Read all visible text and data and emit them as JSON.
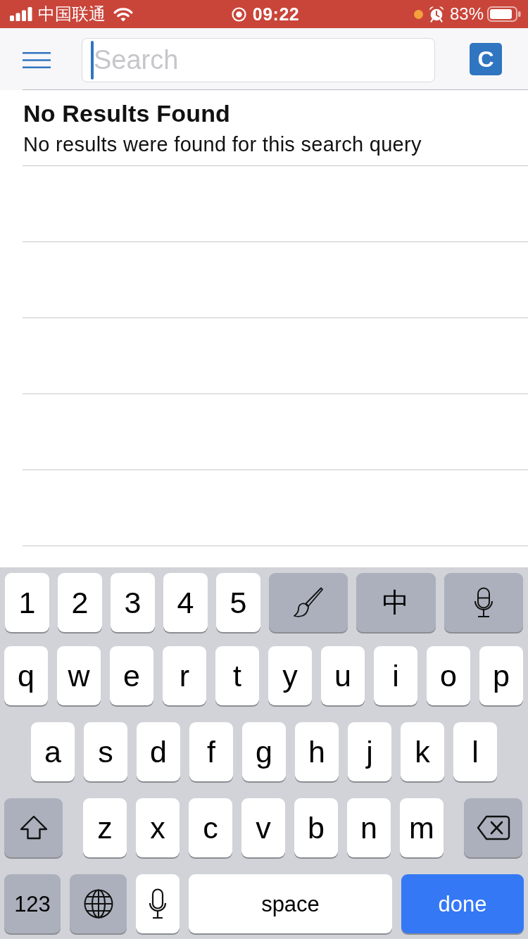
{
  "status_bar": {
    "carrier": "中国联通",
    "time": "09:22",
    "battery": "83%"
  },
  "nav_bar": {
    "search": {
      "placeholder": "Search"
    },
    "profile_initial": "C"
  },
  "results": {
    "title": "No Results Found",
    "message": "No results were found for this search query"
  },
  "keyboard": {
    "rows": [
      {
        "keys": [
          {
            "kind": "char",
            "dark": false,
            "label": "1"
          },
          {
            "kind": "char",
            "dark": false,
            "label": "2"
          },
          {
            "kind": "char",
            "dark": false,
            "label": "3"
          },
          {
            "kind": "char",
            "dark": false,
            "label": "4"
          },
          {
            "kind": "char",
            "dark": false,
            "label": "5"
          },
          {
            "kind": "brush",
            "dark": true
          },
          {
            "kind": "char",
            "dark": true,
            "label": "中"
          },
          {
            "kind": "mic",
            "dark": true
          }
        ]
      },
      {
        "keys": [
          {
            "kind": "char",
            "dark": false,
            "label": "q"
          },
          {
            "kind": "char",
            "dark": false,
            "label": "w"
          },
          {
            "kind": "char",
            "dark": false,
            "label": "e"
          },
          {
            "kind": "char",
            "dark": false,
            "label": "r"
          },
          {
            "kind": "char",
            "dark": false,
            "label": "t"
          },
          {
            "kind": "char",
            "dark": false,
            "label": "y"
          },
          {
            "kind": "char",
            "dark": false,
            "label": "u"
          },
          {
            "kind": "char",
            "dark": false,
            "label": "i"
          },
          {
            "kind": "char",
            "dark": false,
            "label": "o"
          },
          {
            "kind": "char",
            "dark": false,
            "label": "p"
          }
        ]
      },
      {
        "keys": [
          {
            "kind": "char",
            "dark": false,
            "label": "a"
          },
          {
            "kind": "char",
            "dark": false,
            "label": "s"
          },
          {
            "kind": "char",
            "dark": false,
            "label": "d"
          },
          {
            "kind": "char",
            "dark": false,
            "label": "f"
          },
          {
            "kind": "char",
            "dark": false,
            "label": "g"
          },
          {
            "kind": "char",
            "dark": false,
            "label": "h"
          },
          {
            "kind": "char",
            "dark": false,
            "label": "j"
          },
          {
            "kind": "char",
            "dark": false,
            "label": "k"
          },
          {
            "kind": "char",
            "dark": false,
            "label": "l"
          }
        ]
      },
      {
        "keys": [
          {
            "kind": "shift",
            "dark": true
          },
          {
            "kind": "char",
            "dark": false,
            "label": "z"
          },
          {
            "kind": "char",
            "dark": false,
            "label": "x"
          },
          {
            "kind": "char",
            "dark": false,
            "label": "c"
          },
          {
            "kind": "char",
            "dark": false,
            "label": "v"
          },
          {
            "kind": "char",
            "dark": false,
            "label": "b"
          },
          {
            "kind": "char",
            "dark": false,
            "label": "n"
          },
          {
            "kind": "char",
            "dark": false,
            "label": "m"
          },
          {
            "kind": "delete",
            "dark": true
          }
        ]
      },
      {
        "keys": [
          {
            "kind": "char",
            "dark": true,
            "label": "123"
          },
          {
            "kind": "globe",
            "dark": true
          },
          {
            "kind": "mic",
            "dark": false
          },
          {
            "kind": "space",
            "dark": false,
            "label": "space"
          },
          {
            "kind": "return",
            "dark": false,
            "label": "done"
          }
        ]
      }
    ]
  }
}
